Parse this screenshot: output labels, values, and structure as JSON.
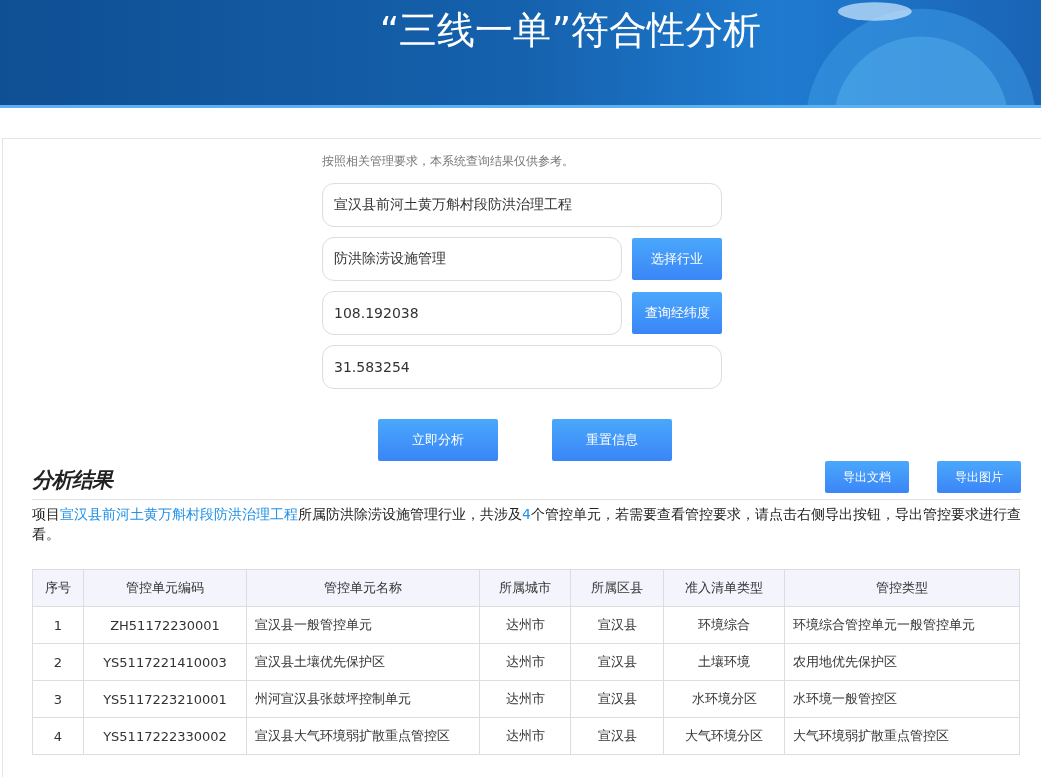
{
  "banner": {
    "title": "“三线一单”符合性分析"
  },
  "form": {
    "notice": "按照相关管理要求，本系统查询结果仅供参考。",
    "fields": [
      {
        "value": "宣汉县前河土黄万斛村段防洪治理工程"
      },
      {
        "value": "防洪除涝设施管理",
        "button": "选择行业"
      },
      {
        "value": "108.192038",
        "button": "查询经纬度"
      },
      {
        "value": "31.583254"
      }
    ],
    "actions": [
      "立即分析",
      "重置信息"
    ]
  },
  "results": {
    "heading": "分析结果",
    "exports": [
      "导出文档",
      "导出图片"
    ],
    "summary": [
      {
        "text": "项目",
        "highlight": false
      },
      {
        "text": "宣汉县前河土黄万斛村段防洪治理工程",
        "highlight": true
      },
      {
        "text": "所属防洪除涝设施管理行业，共涉及",
        "highlight": false
      },
      {
        "text": "4",
        "highlight": true
      },
      {
        "text": "个管控单元，若需要查看管控要求，请点击右侧导出按钮，导出管控要求进行查看。",
        "highlight": false
      }
    ],
    "table": {
      "columns": [
        "序号",
        "管控单元编码",
        "管控单元名称",
        "所属城市",
        "所属区县",
        "准入清单类型",
        "管控类型"
      ],
      "rows": [
        [
          "1",
          "ZH51172230001",
          "宣汉县一般管控单元",
          "达州市",
          "宣汉县",
          "环境综合",
          "环境综合管控单元一般管控单元"
        ],
        [
          "2",
          "YS5117221410003",
          "宣汉县土壤优先保护区",
          "达州市",
          "宣汉县",
          "土壤环境",
          "农用地优先保护区"
        ],
        [
          "3",
          "YS5117223210001",
          "州河宣汉县张鼓坪控制单元",
          "达州市",
          "宣汉县",
          "水环境分区",
          "水环境一般管控区"
        ],
        [
          "4",
          "YS5117222330002",
          "宣汉县大气环境弱扩散重点管控区",
          "达州市",
          "宣汉县",
          "大气环境分区",
          "大气环境弱扩散重点管控区"
        ]
      ]
    }
  }
}
